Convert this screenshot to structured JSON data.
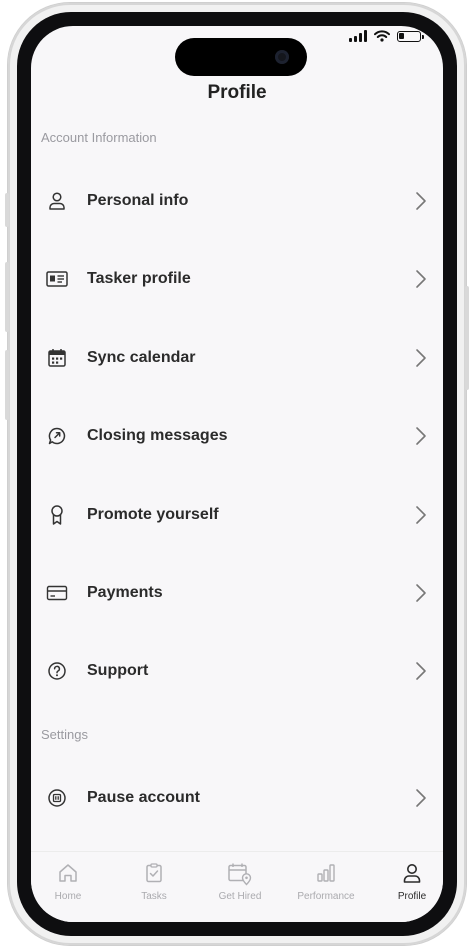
{
  "header": {
    "title": "Profile"
  },
  "sections": {
    "account": "Account Information",
    "settings": "Settings"
  },
  "menu": [
    {
      "label": "Personal info",
      "icon": "person-icon"
    },
    {
      "label": "Tasker profile",
      "icon": "id-card-icon"
    },
    {
      "label": "Sync calendar",
      "icon": "calendar-icon"
    },
    {
      "label": "Closing messages",
      "icon": "chat-bubble-icon"
    },
    {
      "label": "Promote yourself",
      "icon": "award-ribbon-icon"
    },
    {
      "label": "Payments",
      "icon": "credit-card-icon"
    },
    {
      "label": "Support",
      "icon": "question-circle-icon"
    }
  ],
  "settings_menu": [
    {
      "label": "Pause account",
      "icon": "pause-circle-icon"
    }
  ],
  "tabbar": {
    "tabs": [
      {
        "label": "Home",
        "icon": "home-icon",
        "active": false
      },
      {
        "label": "Tasks",
        "icon": "clipboard-check-icon",
        "active": false
      },
      {
        "label": "Get Hired",
        "icon": "calendar-location-icon",
        "active": false
      },
      {
        "label": "Performance",
        "icon": "bar-chart-icon",
        "active": false
      },
      {
        "label": "Profile",
        "icon": "person-icon",
        "active": true
      }
    ]
  },
  "colors": {
    "screen_bg": "#f8f7f9",
    "text_primary": "#2b2b2b",
    "text_muted": "#9a9aa0",
    "bezel": "#0e0e10"
  }
}
